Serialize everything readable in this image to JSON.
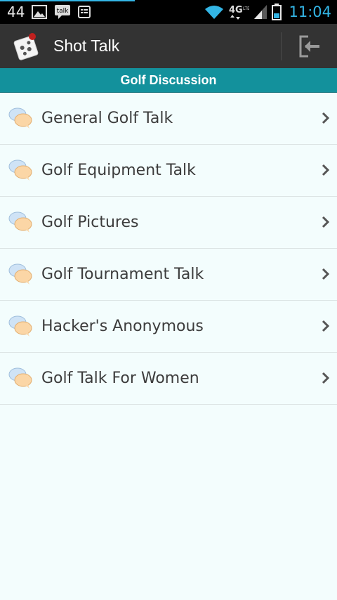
{
  "status_bar": {
    "notification_count": "44",
    "time": "11:04",
    "network_label": "4G",
    "icons": [
      "image-icon",
      "talk-icon",
      "news-icon",
      "wifi-icon",
      "4g-icon",
      "signal-icon",
      "battery-icon"
    ]
  },
  "action_bar": {
    "title": "Shot Talk",
    "logout_icon": "logout-icon"
  },
  "section": {
    "title": "Golf Discussion"
  },
  "forums": [
    {
      "label": "General Golf Talk"
    },
    {
      "label": "Golf Equipment Talk"
    },
    {
      "label": "Golf Pictures"
    },
    {
      "label": "Golf Tournament Talk"
    },
    {
      "label": "Hacker's Anonymous"
    },
    {
      "label": "Golf Talk For Women"
    }
  ],
  "colors": {
    "status_accent": "#33b5e5",
    "action_bar": "#333333",
    "section_header": "#13919c",
    "list_background": "#f3fdfd"
  }
}
